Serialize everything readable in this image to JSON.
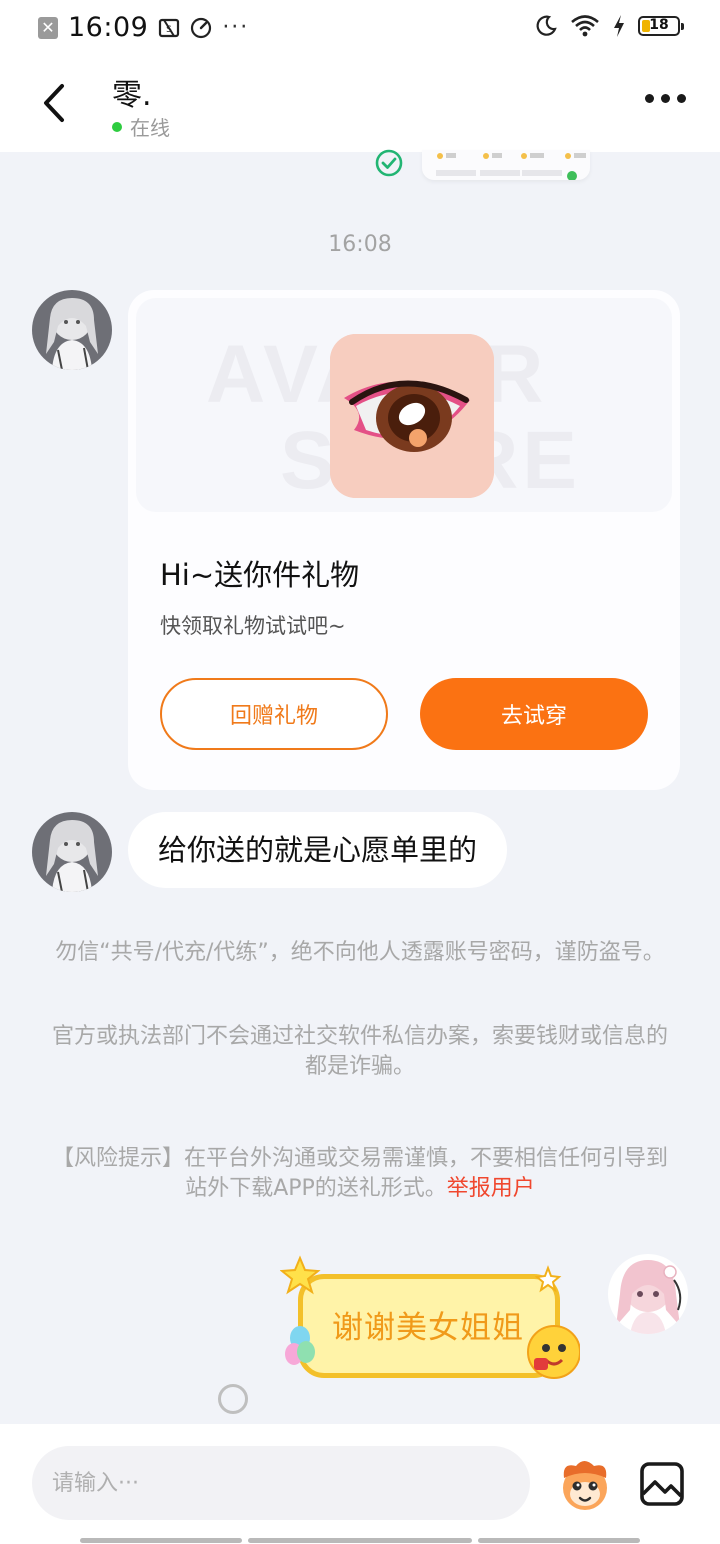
{
  "status_bar": {
    "time": "16:09",
    "more": "···",
    "battery": "18",
    "icons": [
      "notification-x-icon",
      "screenshot-icon",
      "speedometer-icon",
      "moon-icon",
      "wifi-icon",
      "charging-bolt-icon",
      "battery-icon"
    ]
  },
  "header": {
    "name": "零.",
    "status": "在线",
    "status_color": "#2ecc40"
  },
  "messages": {
    "timestamp": "16:08",
    "gift": {
      "watermark_line1": "AVATAR",
      "watermark_line2": "STORE",
      "title": "Hi~送你件礼物",
      "subtitle": "快领取礼物试试吧~",
      "return_gift_label": "回赠礼物",
      "try_on_label": "去试穿",
      "accent": "#fb7212"
    },
    "text_message": "给你送的就是心愿单里的",
    "notice1": "勿信“共号/代充/代练”，绝不向他人透露账号密码，谨防盗号。",
    "notice2": "官方或执法部门不会通过社交软件私信办案，索要钱财或信息的都是诈骗。",
    "notice3": "【风险提示】在平台外沟通或交易需谨慎，不要相信任何引导到站外下载APP的送礼形式。",
    "report_link": "举报用户",
    "sticker_text": "谢谢美女姐姐"
  },
  "composer": {
    "placeholder": "请输入···"
  }
}
